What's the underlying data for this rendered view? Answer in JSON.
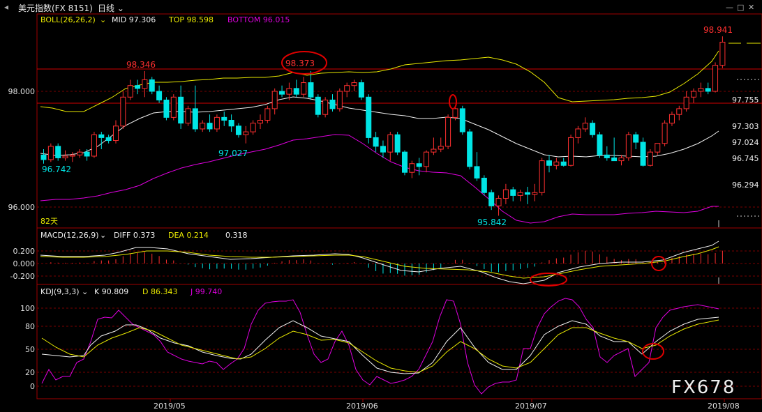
{
  "app": {
    "title": "美元指数(FX 8151)",
    "period": "日线",
    "window_controls": [
      "—",
      "□",
      "✕"
    ]
  },
  "main_panel": {
    "boll_label": "BOLL(26,26,2)",
    "mid_label": "MID 97.306",
    "top_label": "TOP 98.598",
    "bottom_label": "BOTTOM 96.015",
    "y_ticks": [
      "98.000",
      "96.000"
    ],
    "right_ticks": [
      "97.755",
      "97.303",
      "97.024",
      "96.745",
      "96.294"
    ],
    "annotations": [
      "98.941",
      "98.346",
      "98.373",
      "97.027",
      "96.742",
      "95.842"
    ],
    "days_label": "82天"
  },
  "macd_panel": {
    "label": "MACD(12,26,9)",
    "diff_label": "DIFF 0.373",
    "dea_label": "DEA 0.214",
    "macd_value": "0.318",
    "y_ticks": [
      "0.200",
      "0.000",
      "-0.200"
    ]
  },
  "kdj_panel": {
    "label": "KDJ(9,3,3)",
    "k_label": "K 90.809",
    "d_label": "D 86.343",
    "j_label": "J 99.740",
    "y_ticks": [
      "100",
      "80",
      "50",
      "20",
      "0"
    ]
  },
  "x_axis": {
    "labels": [
      "2019/05",
      "2019/06",
      "2019/07",
      "2019/08"
    ]
  },
  "watermark": "FX678",
  "colors": {
    "up": "#ff3030",
    "down": "#00e5e5",
    "mid_line": "#ffffff",
    "top_line": "#e8e800",
    "bottom_line": "#e000e0",
    "grid": "#880000",
    "support_line": "#d00000"
  },
  "chart_data": {
    "type": "candlestick",
    "title": "美元指数(FX 8151) 日线",
    "ylim": [
      95.7,
      99.2
    ],
    "candles": [
      [
        96.9,
        97.0,
        96.75,
        96.82
      ],
      [
        96.82,
        97.1,
        96.78,
        97.05
      ],
      [
        97.05,
        97.1,
        96.8,
        96.85
      ],
      [
        96.85,
        96.98,
        96.8,
        96.88
      ],
      [
        96.88,
        96.95,
        96.78,
        96.9
      ],
      [
        96.9,
        97.0,
        96.85,
        96.95
      ],
      [
        96.95,
        97.0,
        96.8,
        96.88
      ],
      [
        96.88,
        97.3,
        96.85,
        97.25
      ],
      [
        97.25,
        97.3,
        97.0,
        97.2
      ],
      [
        97.2,
        97.25,
        97.1,
        97.15
      ],
      [
        97.15,
        97.5,
        97.1,
        97.4
      ],
      [
        97.4,
        98.0,
        97.35,
        97.9
      ],
      [
        97.9,
        98.2,
        97.85,
        98.1
      ],
      [
        98.1,
        98.2,
        97.95,
        98.05
      ],
      [
        98.05,
        98.35,
        97.9,
        98.2
      ],
      [
        98.2,
        98.25,
        97.95,
        98.0
      ],
      [
        98.0,
        98.1,
        97.8,
        97.85
      ],
      [
        97.85,
        97.9,
        97.5,
        97.55
      ],
      [
        97.55,
        97.95,
        97.5,
        97.9
      ],
      [
        97.9,
        98.1,
        97.35,
        97.45
      ],
      [
        97.45,
        97.75,
        97.4,
        97.7
      ],
      [
        97.7,
        98.1,
        97.3,
        97.35
      ],
      [
        97.35,
        97.5,
        97.3,
        97.45
      ],
      [
        97.45,
        97.6,
        97.3,
        97.35
      ],
      [
        97.35,
        97.6,
        97.3,
        97.55
      ],
      [
        97.55,
        97.65,
        97.4,
        97.5
      ],
      [
        97.5,
        97.6,
        97.3,
        97.4
      ],
      [
        97.4,
        97.45,
        97.2,
        97.25
      ],
      [
        97.25,
        97.4,
        97.1,
        97.3
      ],
      [
        97.3,
        97.5,
        97.25,
        97.45
      ],
      [
        97.45,
        97.6,
        97.35,
        97.5
      ],
      [
        97.5,
        97.75,
        97.45,
        97.7
      ],
      [
        97.7,
        98.05,
        97.6,
        98.0
      ],
      [
        98.0,
        98.1,
        97.9,
        97.95
      ],
      [
        97.95,
        98.15,
        97.85,
        98.05
      ],
      [
        98.05,
        98.2,
        97.9,
        97.95
      ],
      [
        97.95,
        98.25,
        97.9,
        98.15
      ],
      [
        98.15,
        98.35,
        97.85,
        97.9
      ],
      [
        97.9,
        97.95,
        97.55,
        97.6
      ],
      [
        97.6,
        97.9,
        97.55,
        97.85
      ],
      [
        97.85,
        97.95,
        97.65,
        97.7
      ],
      [
        97.7,
        98.05,
        97.65,
        98.0
      ],
      [
        98.0,
        98.15,
        97.9,
        98.1
      ],
      [
        98.1,
        98.2,
        98.0,
        98.15
      ],
      [
        98.15,
        98.2,
        97.85,
        97.9
      ],
      [
        97.9,
        97.95,
        97.1,
        97.2
      ],
      [
        97.2,
        97.3,
        96.95,
        97.05
      ],
      [
        97.05,
        97.15,
        96.85,
        96.95
      ],
      [
        96.95,
        97.3,
        96.8,
        97.25
      ],
      [
        97.25,
        97.3,
        96.9,
        96.95
      ],
      [
        96.95,
        96.98,
        96.55,
        96.6
      ],
      [
        96.6,
        96.8,
        96.5,
        96.75
      ],
      [
        96.75,
        96.85,
        96.55,
        96.7
      ],
      [
        96.7,
        96.98,
        96.6,
        96.95
      ],
      [
        96.95,
        97.2,
        96.9,
        97.0
      ],
      [
        97.0,
        97.2,
        96.95,
        97.05
      ],
      [
        97.05,
        97.6,
        97.0,
        97.55
      ],
      [
        97.55,
        97.75,
        97.5,
        97.7
      ],
      [
        97.7,
        97.75,
        97.25,
        97.3
      ],
      [
        97.3,
        97.35,
        96.65,
        96.7
      ],
      [
        96.7,
        96.95,
        96.45,
        96.5
      ],
      [
        96.5,
        96.55,
        96.2,
        96.25
      ],
      [
        96.25,
        96.3,
        95.95,
        96.02
      ],
      [
        96.02,
        96.2,
        95.85,
        96.15
      ],
      [
        96.15,
        96.4,
        96.05,
        96.3
      ],
      [
        96.3,
        96.35,
        96.1,
        96.2
      ],
      [
        96.2,
        96.3,
        96.1,
        96.25
      ],
      [
        96.25,
        96.35,
        96.05,
        96.22
      ],
      [
        96.22,
        96.4,
        96.1,
        96.25
      ],
      [
        96.25,
        96.85,
        96.2,
        96.8
      ],
      [
        96.8,
        96.9,
        96.6,
        96.72
      ],
      [
        96.72,
        96.85,
        96.65,
        96.78
      ],
      [
        96.78,
        96.85,
        96.7,
        96.72
      ],
      [
        96.72,
        97.25,
        96.7,
        97.2
      ],
      [
        97.2,
        97.4,
        97.1,
        97.35
      ],
      [
        97.35,
        97.55,
        97.3,
        97.45
      ],
      [
        97.45,
        97.5,
        97.2,
        97.25
      ],
      [
        97.25,
        97.3,
        96.85,
        96.9
      ],
      [
        96.9,
        97.05,
        96.8,
        96.85
      ],
      [
        96.85,
        97.2,
        96.8,
        96.8
      ],
      [
        96.8,
        96.9,
        96.72,
        96.85
      ],
      [
        96.85,
        97.3,
        96.8,
        97.25
      ],
      [
        97.25,
        97.3,
        97.0,
        97.12
      ],
      [
        97.12,
        97.2,
        96.7,
        96.72
      ],
      [
        96.72,
        97.0,
        96.7,
        96.95
      ],
      [
        96.95,
        97.1,
        96.9,
        97.1
      ],
      [
        97.1,
        97.5,
        97.05,
        97.45
      ],
      [
        97.45,
        97.65,
        97.4,
        97.6
      ],
      [
        97.6,
        97.75,
        97.5,
        97.7
      ],
      [
        97.7,
        98.0,
        97.65,
        97.9
      ],
      [
        97.9,
        98.05,
        97.8,
        98.0
      ],
      [
        98.0,
        98.15,
        97.9,
        98.05
      ],
      [
        98.05,
        98.15,
        97.95,
        98.0
      ],
      [
        98.0,
        98.5,
        97.98,
        98.45
      ],
      [
        98.45,
        98.95,
        98.4,
        98.85
      ]
    ]
  }
}
